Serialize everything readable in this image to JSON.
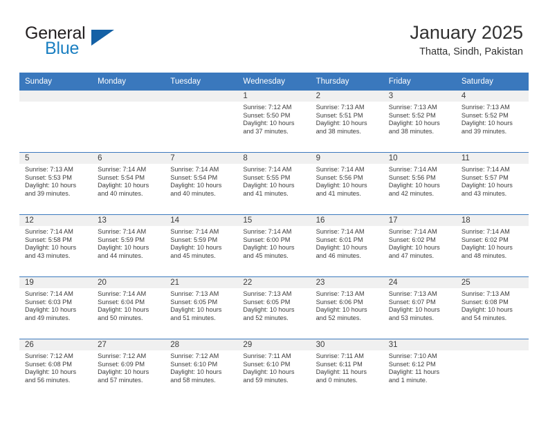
{
  "brand": {
    "word1": "General",
    "word2": "Blue",
    "triangle_color": "#1461a6",
    "blue_color": "#1a7fc1"
  },
  "header": {
    "title": "January 2025",
    "subtitle": "Thatta, Sindh, Pakistan"
  },
  "theme": {
    "header_bg": "#3a78bd",
    "daynum_bg": "#f0f0f0",
    "text": "#3b3b3b"
  },
  "weekdays": [
    "Sunday",
    "Monday",
    "Tuesday",
    "Wednesday",
    "Thursday",
    "Friday",
    "Saturday"
  ],
  "labels": {
    "sunrise": "Sunrise:",
    "sunset": "Sunset:",
    "daylight": "Daylight:"
  },
  "weeks": [
    [
      {
        "day": "",
        "empty": true
      },
      {
        "day": "",
        "empty": true
      },
      {
        "day": "",
        "empty": true
      },
      {
        "day": "1",
        "sunrise": "Sunrise: 7:12 AM",
        "sunset": "Sunset: 5:50 PM",
        "daylight1": "Daylight: 10 hours",
        "daylight2": "and 37 minutes."
      },
      {
        "day": "2",
        "sunrise": "Sunrise: 7:13 AM",
        "sunset": "Sunset: 5:51 PM",
        "daylight1": "Daylight: 10 hours",
        "daylight2": "and 38 minutes."
      },
      {
        "day": "3",
        "sunrise": "Sunrise: 7:13 AM",
        "sunset": "Sunset: 5:52 PM",
        "daylight1": "Daylight: 10 hours",
        "daylight2": "and 38 minutes."
      },
      {
        "day": "4",
        "sunrise": "Sunrise: 7:13 AM",
        "sunset": "Sunset: 5:52 PM",
        "daylight1": "Daylight: 10 hours",
        "daylight2": "and 39 minutes."
      }
    ],
    [
      {
        "day": "5",
        "sunrise": "Sunrise: 7:13 AM",
        "sunset": "Sunset: 5:53 PM",
        "daylight1": "Daylight: 10 hours",
        "daylight2": "and 39 minutes."
      },
      {
        "day": "6",
        "sunrise": "Sunrise: 7:14 AM",
        "sunset": "Sunset: 5:54 PM",
        "daylight1": "Daylight: 10 hours",
        "daylight2": "and 40 minutes."
      },
      {
        "day": "7",
        "sunrise": "Sunrise: 7:14 AM",
        "sunset": "Sunset: 5:54 PM",
        "daylight1": "Daylight: 10 hours",
        "daylight2": "and 40 minutes."
      },
      {
        "day": "8",
        "sunrise": "Sunrise: 7:14 AM",
        "sunset": "Sunset: 5:55 PM",
        "daylight1": "Daylight: 10 hours",
        "daylight2": "and 41 minutes."
      },
      {
        "day": "9",
        "sunrise": "Sunrise: 7:14 AM",
        "sunset": "Sunset: 5:56 PM",
        "daylight1": "Daylight: 10 hours",
        "daylight2": "and 41 minutes."
      },
      {
        "day": "10",
        "sunrise": "Sunrise: 7:14 AM",
        "sunset": "Sunset: 5:56 PM",
        "daylight1": "Daylight: 10 hours",
        "daylight2": "and 42 minutes."
      },
      {
        "day": "11",
        "sunrise": "Sunrise: 7:14 AM",
        "sunset": "Sunset: 5:57 PM",
        "daylight1": "Daylight: 10 hours",
        "daylight2": "and 43 minutes."
      }
    ],
    [
      {
        "day": "12",
        "sunrise": "Sunrise: 7:14 AM",
        "sunset": "Sunset: 5:58 PM",
        "daylight1": "Daylight: 10 hours",
        "daylight2": "and 43 minutes."
      },
      {
        "day": "13",
        "sunrise": "Sunrise: 7:14 AM",
        "sunset": "Sunset: 5:59 PM",
        "daylight1": "Daylight: 10 hours",
        "daylight2": "and 44 minutes."
      },
      {
        "day": "14",
        "sunrise": "Sunrise: 7:14 AM",
        "sunset": "Sunset: 5:59 PM",
        "daylight1": "Daylight: 10 hours",
        "daylight2": "and 45 minutes."
      },
      {
        "day": "15",
        "sunrise": "Sunrise: 7:14 AM",
        "sunset": "Sunset: 6:00 PM",
        "daylight1": "Daylight: 10 hours",
        "daylight2": "and 45 minutes."
      },
      {
        "day": "16",
        "sunrise": "Sunrise: 7:14 AM",
        "sunset": "Sunset: 6:01 PM",
        "daylight1": "Daylight: 10 hours",
        "daylight2": "and 46 minutes."
      },
      {
        "day": "17",
        "sunrise": "Sunrise: 7:14 AM",
        "sunset": "Sunset: 6:02 PM",
        "daylight1": "Daylight: 10 hours",
        "daylight2": "and 47 minutes."
      },
      {
        "day": "18",
        "sunrise": "Sunrise: 7:14 AM",
        "sunset": "Sunset: 6:02 PM",
        "daylight1": "Daylight: 10 hours",
        "daylight2": "and 48 minutes."
      }
    ],
    [
      {
        "day": "19",
        "sunrise": "Sunrise: 7:14 AM",
        "sunset": "Sunset: 6:03 PM",
        "daylight1": "Daylight: 10 hours",
        "daylight2": "and 49 minutes."
      },
      {
        "day": "20",
        "sunrise": "Sunrise: 7:14 AM",
        "sunset": "Sunset: 6:04 PM",
        "daylight1": "Daylight: 10 hours",
        "daylight2": "and 50 minutes."
      },
      {
        "day": "21",
        "sunrise": "Sunrise: 7:13 AM",
        "sunset": "Sunset: 6:05 PM",
        "daylight1": "Daylight: 10 hours",
        "daylight2": "and 51 minutes."
      },
      {
        "day": "22",
        "sunrise": "Sunrise: 7:13 AM",
        "sunset": "Sunset: 6:05 PM",
        "daylight1": "Daylight: 10 hours",
        "daylight2": "and 52 minutes."
      },
      {
        "day": "23",
        "sunrise": "Sunrise: 7:13 AM",
        "sunset": "Sunset: 6:06 PM",
        "daylight1": "Daylight: 10 hours",
        "daylight2": "and 52 minutes."
      },
      {
        "day": "24",
        "sunrise": "Sunrise: 7:13 AM",
        "sunset": "Sunset: 6:07 PM",
        "daylight1": "Daylight: 10 hours",
        "daylight2": "and 53 minutes."
      },
      {
        "day": "25",
        "sunrise": "Sunrise: 7:13 AM",
        "sunset": "Sunset: 6:08 PM",
        "daylight1": "Daylight: 10 hours",
        "daylight2": "and 54 minutes."
      }
    ],
    [
      {
        "day": "26",
        "sunrise": "Sunrise: 7:12 AM",
        "sunset": "Sunset: 6:08 PM",
        "daylight1": "Daylight: 10 hours",
        "daylight2": "and 56 minutes."
      },
      {
        "day": "27",
        "sunrise": "Sunrise: 7:12 AM",
        "sunset": "Sunset: 6:09 PM",
        "daylight1": "Daylight: 10 hours",
        "daylight2": "and 57 minutes."
      },
      {
        "day": "28",
        "sunrise": "Sunrise: 7:12 AM",
        "sunset": "Sunset: 6:10 PM",
        "daylight1": "Daylight: 10 hours",
        "daylight2": "and 58 minutes."
      },
      {
        "day": "29",
        "sunrise": "Sunrise: 7:11 AM",
        "sunset": "Sunset: 6:10 PM",
        "daylight1": "Daylight: 10 hours",
        "daylight2": "and 59 minutes."
      },
      {
        "day": "30",
        "sunrise": "Sunrise: 7:11 AM",
        "sunset": "Sunset: 6:11 PM",
        "daylight1": "Daylight: 11 hours",
        "daylight2": "and 0 minutes."
      },
      {
        "day": "31",
        "sunrise": "Sunrise: 7:10 AM",
        "sunset": "Sunset: 6:12 PM",
        "daylight1": "Daylight: 11 hours",
        "daylight2": "and 1 minute."
      },
      {
        "day": "",
        "empty": true
      }
    ]
  ]
}
